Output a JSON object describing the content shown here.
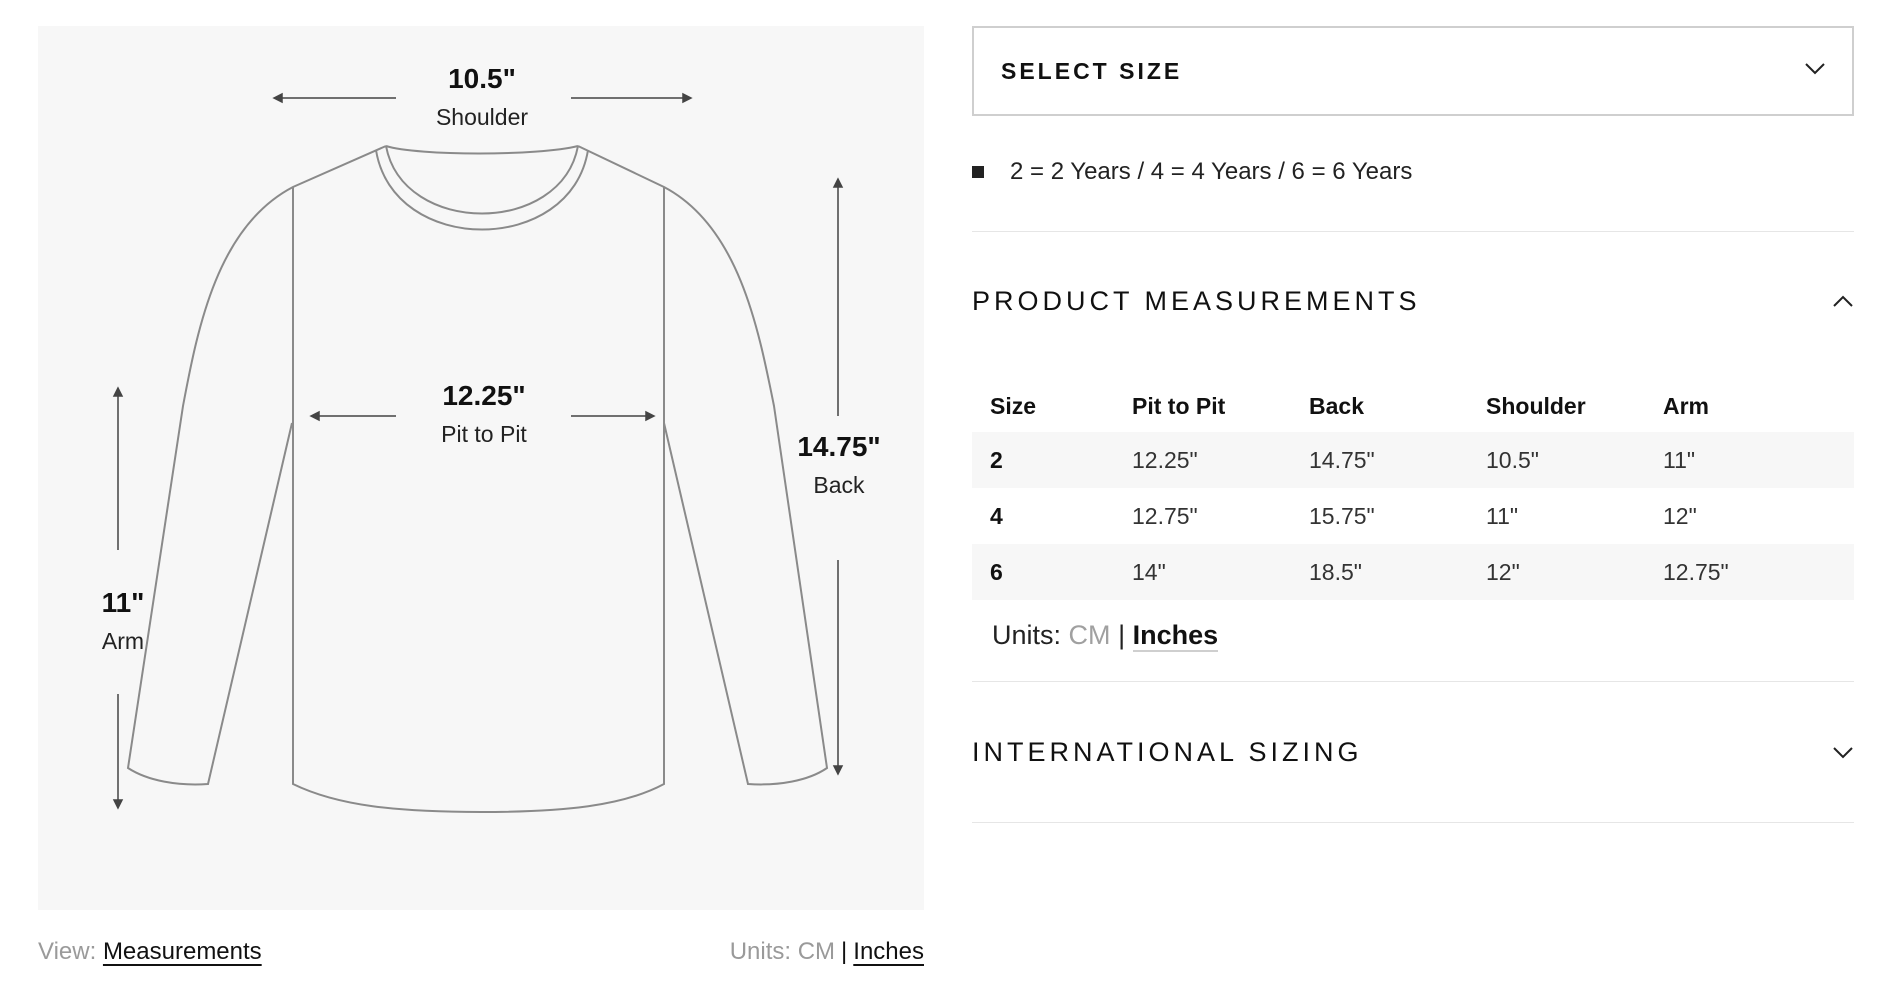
{
  "diagram": {
    "shoulder": {
      "value": "10.5\"",
      "label": "Shoulder"
    },
    "pit": {
      "value": "12.25\"",
      "label": "Pit to Pit"
    },
    "back": {
      "value": "14.75\"",
      "label": "Back"
    },
    "arm": {
      "value": "11\"",
      "label": "Arm"
    }
  },
  "view_bar": {
    "prefix": "View:",
    "active": "Measurements"
  },
  "units_left": {
    "prefix": "Units:",
    "cm": "CM",
    "separator": "|",
    "active": "Inches"
  },
  "select_size": {
    "label": "SELECT SIZE",
    "icon": "chevron-down-icon"
  },
  "size_note": "2 = 2 Years / 4 = 4 Years / 6 = 6 Years",
  "product_measurements": {
    "title": "PRODUCT MEASUREMENTS",
    "icon": "chevron-up-icon",
    "headers": [
      "Size",
      "Pit to Pit",
      "Back",
      "Shoulder",
      "Arm"
    ],
    "rows": [
      [
        "2",
        "12.25\"",
        "14.75\"",
        "10.5\"",
        "11\""
      ],
      [
        "4",
        "12.75\"",
        "15.75\"",
        "11\"",
        "12\""
      ],
      [
        "6",
        "14\"",
        "18.5\"",
        "12\"",
        "12.75\""
      ]
    ],
    "units": {
      "prefix": "Units:",
      "cm": "CM",
      "separator": "|",
      "active": "Inches"
    }
  },
  "international_sizing": {
    "title": "INTERNATIONAL SIZING",
    "icon": "chevron-down-icon"
  },
  "colors": {
    "panel_bg": "#f7f7f7",
    "text": "#111111",
    "muted": "#9a9a9a",
    "row_shade": "#f7f7f7",
    "border": "#cfcfcf"
  }
}
